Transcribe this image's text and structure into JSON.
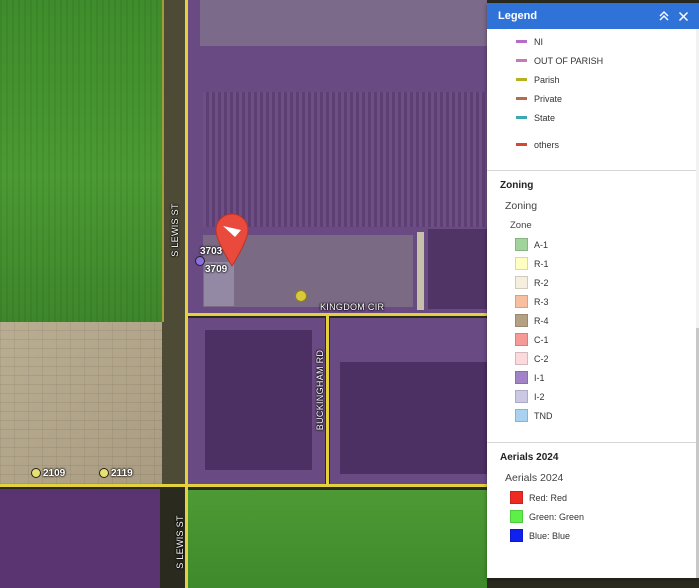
{
  "map": {
    "roads": {
      "s_lewis_north": "S LEWIS ST",
      "kingdom_cir": "KINGDOM CIR",
      "buckingham_rd": "BUCKINGHAM RD",
      "s_lewis_south": "S LEWIS ST"
    },
    "addresses": [
      {
        "label": "3703",
        "dot_color": "#8a6fe0"
      },
      {
        "label": "3709"
      },
      {
        "label": "2109",
        "dot_color": "#e8e070"
      },
      {
        "label": "2119",
        "dot_color": "#e8e070"
      }
    ],
    "marker": {
      "icon": "location-pin-icon",
      "color": "#ea4a3c"
    },
    "extra_point": {
      "color": "#d8c93a"
    }
  },
  "legend": {
    "title": "Legend",
    "controls": {
      "collapse_icon": "double-chevron-up-icon",
      "close_icon": "close-icon"
    },
    "road_ownership": [
      {
        "label": "NI",
        "color": "#b66bc7"
      },
      {
        "label": "OUT OF PARISH",
        "color": "#c678b8"
      },
      {
        "label": "Parish",
        "color": "#b9b021"
      },
      {
        "label": "Private",
        "color": "#b76b4a"
      },
      {
        "label": "State",
        "color": "#3ea8b0"
      },
      {
        "label": "others",
        "color": "#d64732"
      }
    ],
    "zoning": {
      "title": "Zoning",
      "layer": "Zoning",
      "field": "Zone",
      "items": [
        {
          "label": "A-1",
          "color": "#a3d39c"
        },
        {
          "label": "R-1",
          "color": "#ffffc2"
        },
        {
          "label": "R-2",
          "color": "#f6efdf"
        },
        {
          "label": "R-3",
          "color": "#f8bf9f"
        },
        {
          "label": "R-4",
          "color": "#b4a184"
        },
        {
          "label": "C-1",
          "color": "#f59a96"
        },
        {
          "label": "C-2",
          "color": "#fbd9dd"
        },
        {
          "label": "I-1",
          "color": "#a383c7"
        },
        {
          "label": "I-2",
          "color": "#cbc8e6"
        },
        {
          "label": "TND",
          "color": "#a8d2f0"
        }
      ]
    },
    "aerials": {
      "title": "Aerials 2024",
      "layer": "Aerials 2024",
      "items": [
        {
          "label": "Red: Red",
          "color": "#ee2a24"
        },
        {
          "label": "Green: Green",
          "color": "#5df048"
        },
        {
          "label": "Blue: Blue",
          "color": "#1020ee"
        }
      ]
    }
  }
}
